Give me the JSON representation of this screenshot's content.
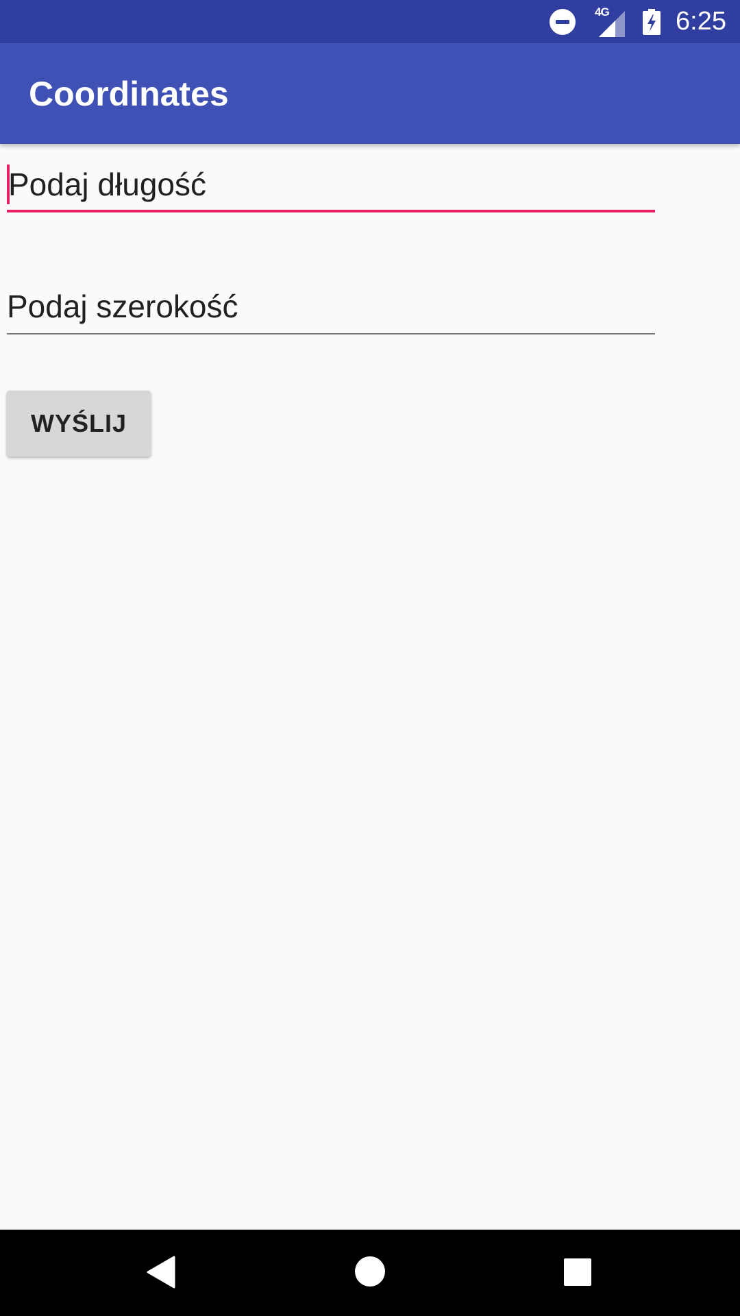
{
  "status_bar": {
    "time": "6:25",
    "network_label": "4G",
    "icons": [
      "do-not-disturb-icon",
      "signal-icon",
      "battery-charging-icon"
    ]
  },
  "app_bar": {
    "title": "Coordinates"
  },
  "form": {
    "longitude_placeholder": "Podaj długość",
    "latitude_placeholder": "Podaj szerokość",
    "submit_label": "WYŚLIJ"
  },
  "nav_bar": {
    "icons": [
      "back-icon",
      "home-icon",
      "recents-icon"
    ]
  },
  "colors": {
    "status_bar": "#303f9f",
    "app_bar": "#3f51b5",
    "accent": "#e91e63",
    "background": "#fafafa",
    "button": "#d6d7d7"
  }
}
